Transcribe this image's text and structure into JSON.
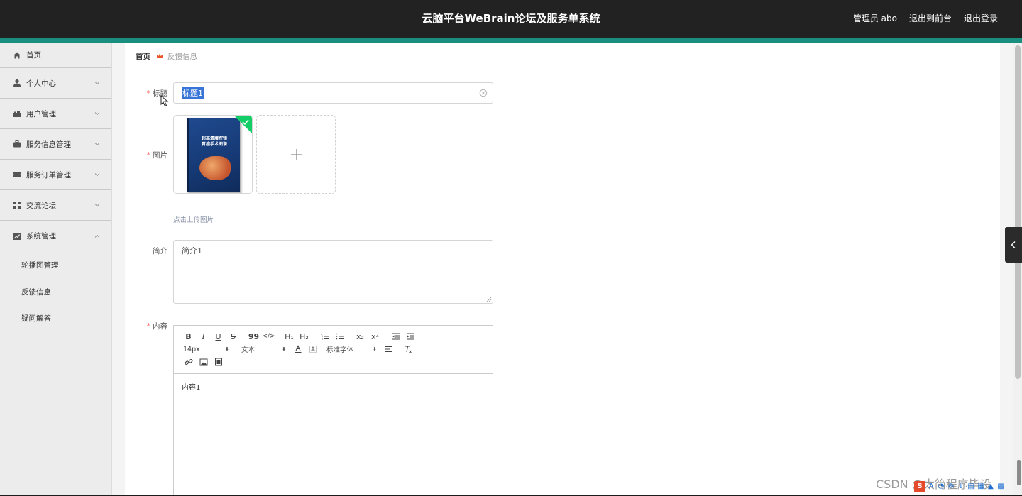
{
  "header": {
    "app_title": "云脑平台WeBrain论坛及服务单系统",
    "admin_label": "管理员 abo",
    "to_frontend": "退出到前台",
    "logout": "退出登录"
  },
  "sidebar": {
    "items": [
      {
        "label": "首页",
        "icon": "home-icon"
      },
      {
        "label": "个人中心",
        "icon": "user-icon"
      },
      {
        "label": "用户管理",
        "icon": "users-icon"
      },
      {
        "label": "服务信息管理",
        "icon": "briefcase-icon"
      },
      {
        "label": "服务订单管理",
        "icon": "ticket-icon"
      },
      {
        "label": "交流论坛",
        "icon": "grid-icon"
      },
      {
        "label": "系统管理",
        "icon": "chart-icon"
      }
    ],
    "sub_items": [
      "轮播图管理",
      "反馈信息",
      "疑问解答"
    ]
  },
  "breadcrumb": {
    "home": "首页",
    "current": "反馈信息"
  },
  "form": {
    "title_label": "标题",
    "title_value": "标题1",
    "image_label": "图片",
    "upload_tip": "点击上传图片",
    "book_title_line1": "超高清腹腔镜",
    "book_title_line2": "胃癌手术图谱",
    "summary_label": "简介",
    "summary_value": "简介1",
    "content_label": "内容",
    "content_value": "内容1",
    "required_mark": "*"
  },
  "editor": {
    "font_size": "14px",
    "text_type": "文本",
    "font_family": "标准字体",
    "row1_buttons": [
      "B",
      "I",
      "U",
      "S",
      "99",
      "</>",
      "H1",
      "H2",
      "ol",
      "ul",
      "x2",
      "x2",
      "outdent",
      "indent"
    ],
    "h1": "H₁",
    "h2": "H₂",
    "sub": "x₂",
    "sup": "x²"
  },
  "watermark": "CSDN @太简程序毕设",
  "colors": {
    "topbar": "#222222",
    "accent_strip": "#1a8f80",
    "required": "#f56c6c",
    "success_badge": "#13ce66",
    "selection": "#3875d7"
  }
}
